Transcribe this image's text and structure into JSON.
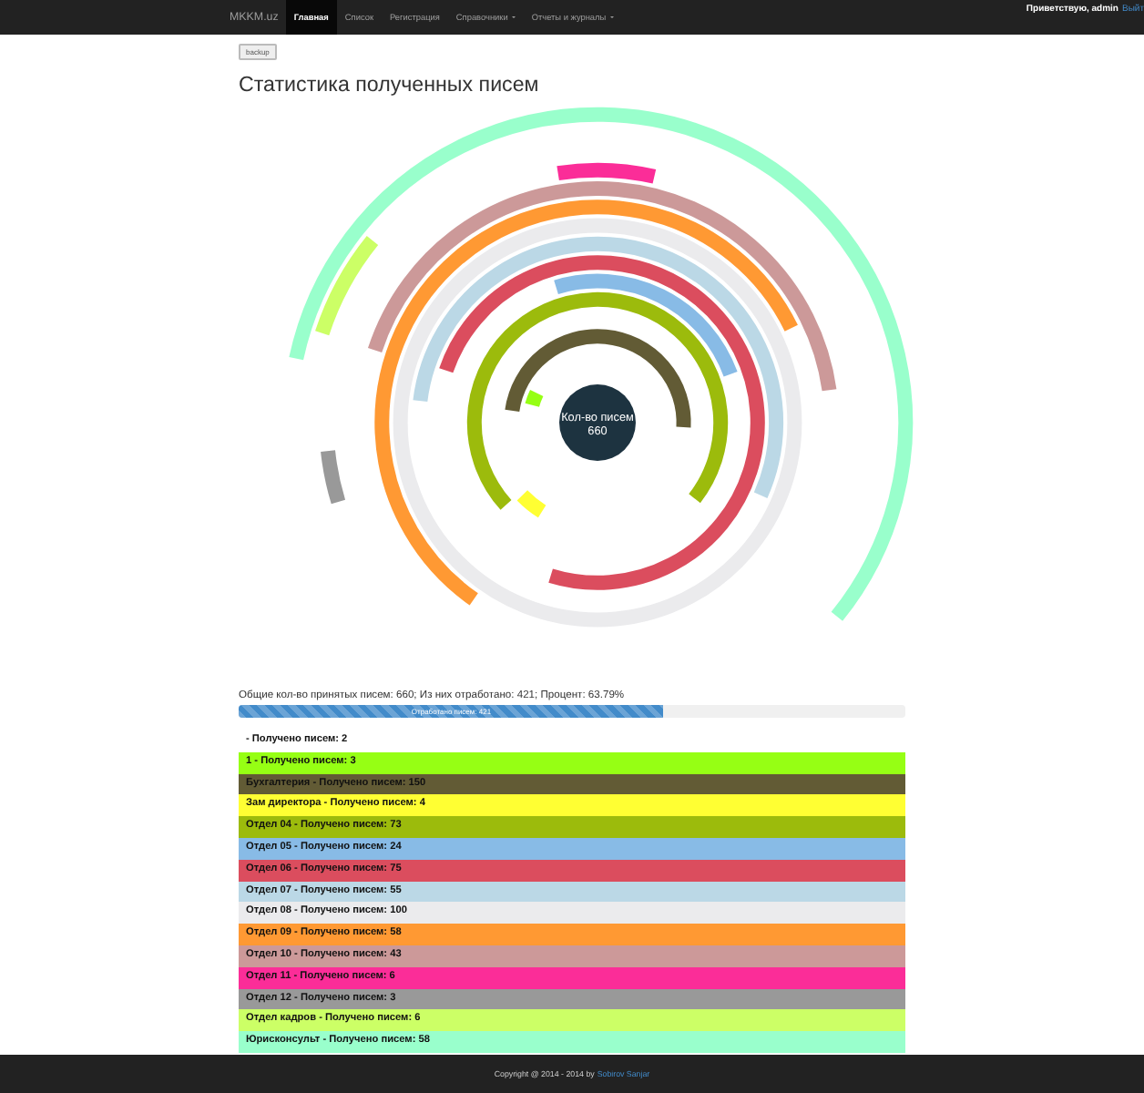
{
  "navbar": {
    "brand": "MKKM.uz",
    "items": [
      {
        "label": "Главная",
        "selected": true,
        "dropdown": false
      },
      {
        "label": "Список",
        "selected": false,
        "dropdown": false
      },
      {
        "label": "Регистрация",
        "selected": false,
        "dropdown": false
      },
      {
        "label": "Справочники",
        "selected": false,
        "dropdown": true
      },
      {
        "label": "Отчеты и журналы",
        "selected": false,
        "dropdown": true
      }
    ],
    "greeting": "Приветствую, admin",
    "logout": "Выйт"
  },
  "backup_button": "backup",
  "title": "Статистика полученных писем",
  "chart": {
    "center_label": "Кол-во писем",
    "center_value": "660"
  },
  "summary": "Общие кол-во принятых писем: 660; Из них отработано: 421; Процент: 63.79%",
  "progress": {
    "label": "Отработано писем: 421",
    "level": 0.6379
  },
  "departments": [
    {
      "label": "- Получено писем: 2"
    },
    {
      "label": "1 - Получено писем: 3",
      "color": "#96ff14"
    },
    {
      "label": "Бухгалтерия - Получено писем: 150",
      "color": "#625b35"
    },
    {
      "label": "Зам директора - Получено писем: 4",
      "color": "#ffff33"
    },
    {
      "label": "Отдел 04 - Получено писем: 73",
      "color": "#9cbb0c"
    },
    {
      "label": "Отдел 05 - Получено писем: 24",
      "color": "#88bbe6"
    },
    {
      "label": "Отдел 06 - Получено писем: 75",
      "color": "#db4d5e"
    },
    {
      "label": "Отдел 07 - Получено писем: 55",
      "color": "#bbd8e6"
    },
    {
      "label": "Отдел 08 - Получено писем: 100",
      "color": "#ebebed"
    },
    {
      "label": "Отдел 09 - Получено писем: 58",
      "color": "#ff9933"
    },
    {
      "label": "Отдел 10 - Получено писем: 43",
      "color": "#cc9999"
    },
    {
      "label": "Отдел 11 - Получено писем: 6",
      "color": "#fb2d98"
    },
    {
      "label": "Отдел 12 - Получено писем: 3",
      "color": "#999999"
    },
    {
      "label": "Отдел кадров - Получено писем: 6",
      "color": "#ccff66"
    },
    {
      "label": "Юрисконсульт - Получено писем: 58",
      "color": "#99ffcc"
    }
  ],
  "footer": {
    "text": "Copyright @ 2014 - 2014 by",
    "link": "Sobirov Sanjar"
  }
}
